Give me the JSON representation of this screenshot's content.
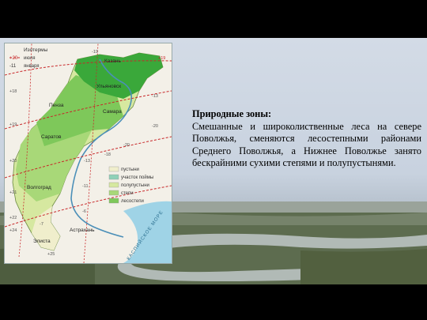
{
  "slide": {
    "heading": "Природные зоны:",
    "body": "Смешанные и широколиственные леса на севере Поволжья, сменяются лесостепными районами Среднего Поволжья, а Нижнее Поволжье занято бескрайними сухими степями и полупустынями."
  },
  "map": {
    "isotherms_title": "Изотермы",
    "isotherm_july": "июля",
    "isotherm_january": "января",
    "isotherm_july_value": "+20",
    "isotherm_january_value": "-11",
    "cities": [
      "Казань",
      "Ульяновск",
      "Пенза",
      "Самара",
      "Саратов",
      "Волгоград",
      "Астрахань",
      "Элиста"
    ],
    "temperatures": [
      "-19",
      "+19",
      "+18",
      "-13",
      "+19",
      "-20",
      "+20",
      "-20",
      "-13",
      "-18",
      "+21",
      "-11",
      "+22",
      "+24",
      "-7",
      "-6",
      "+25"
    ],
    "legend": [
      "пустыни",
      "участок поймы",
      "полупустыни",
      "степи",
      "лесостепи"
    ],
    "sea_label": "КАСПИЙСКОЕ МОРЕ",
    "colors": {
      "forest": "#3aa83a",
      "forest_steppe": "#7ec85a",
      "steppe": "#a8d878",
      "semi_desert": "#d6e8a0",
      "desert": "#f0eecc",
      "floodplain": "#8fd0b8",
      "isotherm": "#c8282a",
      "sea": "#9fd3e6"
    }
  }
}
